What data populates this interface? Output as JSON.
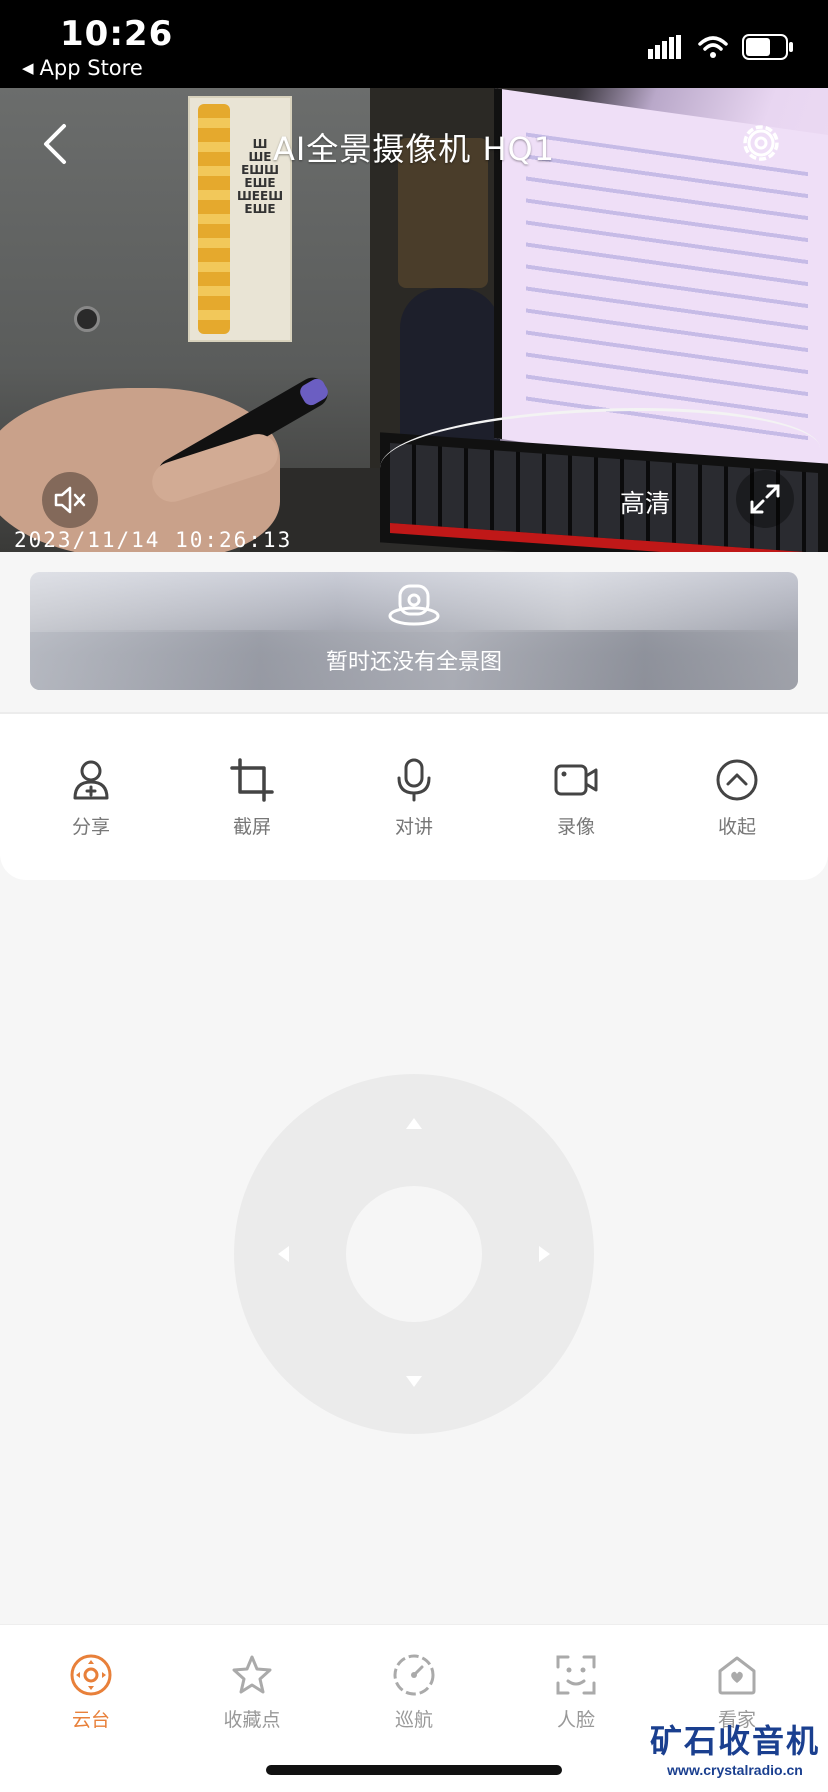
{
  "status_bar": {
    "time": "10:26",
    "back_app": "App Store",
    "icons": [
      "signal-icon",
      "wifi-icon",
      "battery-icon"
    ]
  },
  "header": {
    "title": "AI全景摄像机 HQ1",
    "icons": [
      "back-icon",
      "settings-icon"
    ]
  },
  "video": {
    "quality_label": "高清",
    "timestamp": "2023/11/14  10:26:13",
    "icons": [
      "mute-icon",
      "fullscreen-icon"
    ]
  },
  "panorama": {
    "empty_text": "暂时还没有全景图",
    "icon": "camera-panorama-icon"
  },
  "actions": [
    {
      "label": "分享",
      "icon": "share-user-icon"
    },
    {
      "label": "截屏",
      "icon": "crop-icon"
    },
    {
      "label": "对讲",
      "icon": "microphone-icon"
    },
    {
      "label": "录像",
      "icon": "video-record-icon"
    },
    {
      "label": "收起",
      "icon": "collapse-icon"
    }
  ],
  "ptz": {
    "directions": [
      "up",
      "down",
      "left",
      "right"
    ]
  },
  "tabs": [
    {
      "label": "云台",
      "icon": "ptz-icon",
      "active": true
    },
    {
      "label": "收藏点",
      "icon": "star-icon",
      "active": false
    },
    {
      "label": "巡航",
      "icon": "cruise-icon",
      "active": false
    },
    {
      "label": "人脸",
      "icon": "face-icon",
      "active": false
    },
    {
      "label": "看家",
      "icon": "home-guard-icon",
      "active": false
    }
  ],
  "watermark": {
    "main": "矿石收音机",
    "sub": "www.crystalradio.cn"
  },
  "colors": {
    "accent": "#e8803a",
    "inactive": "#999999",
    "background": "#f6f6f6"
  }
}
